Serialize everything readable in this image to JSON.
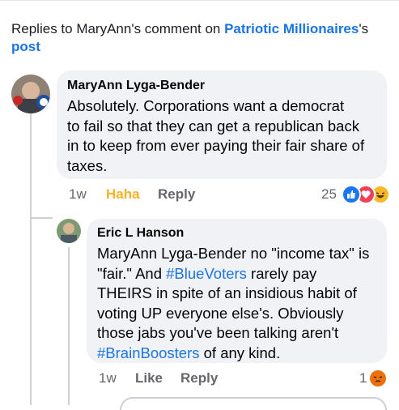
{
  "header": {
    "prefix": "Replies to MaryAnn's comment on ",
    "page_name": "Patriotic Millionaires",
    "suffix": "'s",
    "post_word": "post"
  },
  "comments": [
    {
      "author": "MaryAnn Lyga-Bender",
      "lines": [
        "Absolutely.  Corporations want a democrat",
        "to fail so that they can get a republican back",
        "in to keep from ever paying their fair share of",
        "taxes."
      ],
      "time": "1w",
      "reaction_label": "Haha",
      "reply_label": "Reply",
      "reaction_count": "25"
    },
    {
      "author": "Eric L Hanson",
      "line1": "MaryAnn Lyga-Bender no \"income tax\" is",
      "line2_pre": "\"fair.\"  And ",
      "line2_tag": "#BlueVoters",
      "line2_post": " rarely pay",
      "line3": "THEIRS in spite of an insidious habit of",
      "line4": "voting UP everyone else's.  Obviously",
      "line5": "those jabs you've been talking aren't",
      "line6_tag": "#BrainBoosters",
      "line6_post": " of any kind.",
      "time": "1w",
      "like_label": "Like",
      "reply_label": "Reply",
      "reaction_count": "1"
    }
  ],
  "colors": {
    "link": "#1b74e4",
    "bubble": "#f0f2f5",
    "haha": "#f7b125",
    "secondary": "#65676b"
  },
  "icons": [
    "like-icon",
    "love-icon",
    "haha-icon",
    "angry-icon"
  ]
}
